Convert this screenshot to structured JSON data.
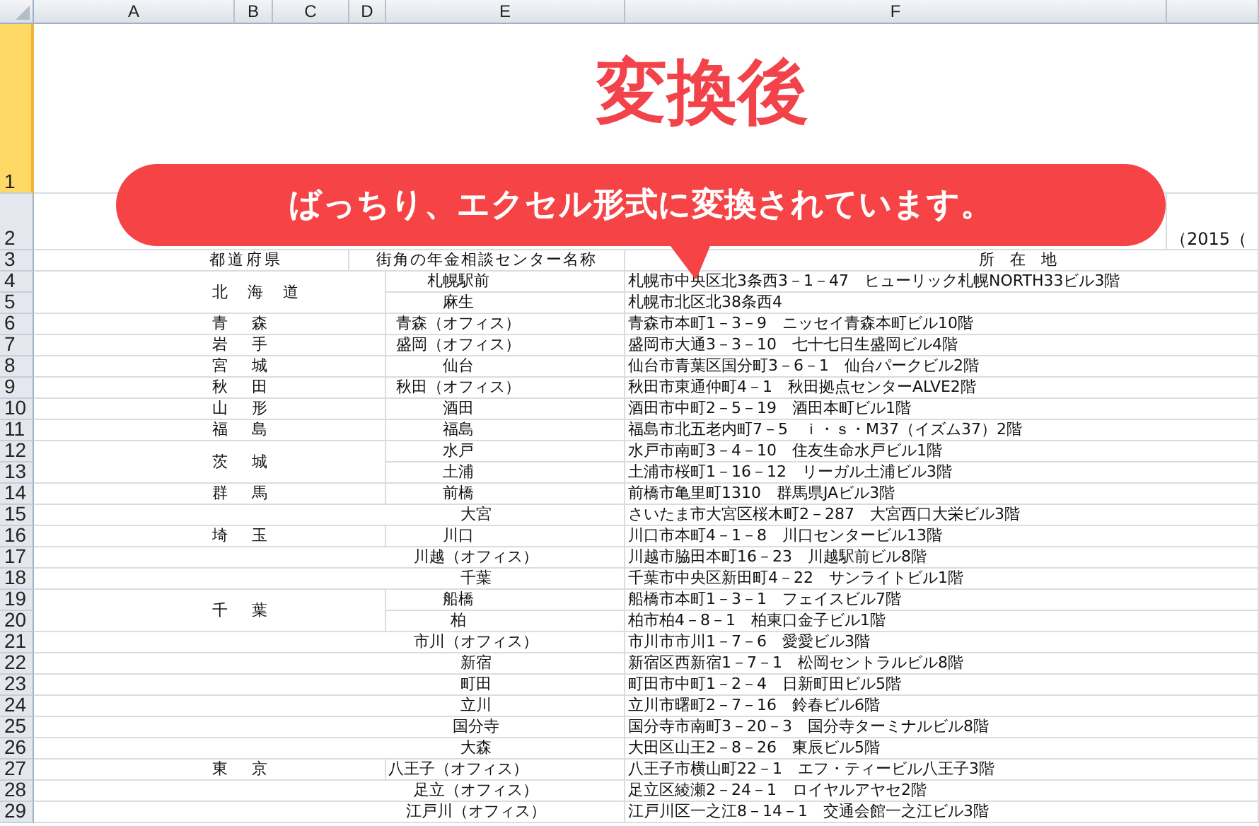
{
  "column_headers": [
    "A",
    "B",
    "C",
    "D",
    "E",
    "F"
  ],
  "row_headers": [
    {
      "label": "1",
      "selected": true
    },
    {
      "label": "2",
      "selected": false
    },
    {
      "label": "3",
      "selected": false
    },
    {
      "label": "4",
      "selected": false
    },
    {
      "label": "5",
      "selected": false
    },
    {
      "label": "6",
      "selected": false
    },
    {
      "label": "7",
      "selected": false
    },
    {
      "label": "8",
      "selected": false
    },
    {
      "label": "9",
      "selected": false
    },
    {
      "label": "10",
      "selected": false
    },
    {
      "label": "11",
      "selected": false
    },
    {
      "label": "12",
      "selected": false
    },
    {
      "label": "13",
      "selected": false
    },
    {
      "label": "14",
      "selected": false
    },
    {
      "label": "15",
      "selected": false
    },
    {
      "label": "16",
      "selected": false
    },
    {
      "label": "17",
      "selected": false
    },
    {
      "label": "18",
      "selected": false
    },
    {
      "label": "19",
      "selected": false
    },
    {
      "label": "20",
      "selected": false
    },
    {
      "label": "21",
      "selected": false
    },
    {
      "label": "22",
      "selected": false
    },
    {
      "label": "23",
      "selected": false
    },
    {
      "label": "24",
      "selected": false
    },
    {
      "label": "25",
      "selected": false
    },
    {
      "label": "26",
      "selected": false
    },
    {
      "label": "27",
      "selected": false
    },
    {
      "label": "28",
      "selected": false
    },
    {
      "label": "29",
      "selected": false
    }
  ],
  "title": "変換後",
  "callout": "ばっちり、エクセル形式に変換されています。",
  "note": "（2015（",
  "header_row": {
    "prefecture": "都道府県",
    "office": "街角の年金相談センター名称",
    "address": "所　在　地"
  },
  "groups": [
    {
      "prefecture": "北海道",
      "offices": [
        {
          "name": "札幌駅前",
          "address": "札幌市中央区北3条西3－1－47　ヒューリック札幌NORTH33ビル3階"
        },
        {
          "name": "麻生",
          "address": "札幌市北区北38条西4"
        }
      ]
    },
    {
      "prefecture": "青森",
      "offices": [
        {
          "name": "青森（オフィス）",
          "address": "青森市本町1－3－9　ニッセイ青森本町ビル10階"
        }
      ]
    },
    {
      "prefecture": "岩手",
      "offices": [
        {
          "name": "盛岡（オフィス）",
          "address": "盛岡市大通3－3－10　七十七日生盛岡ビル4階"
        }
      ]
    },
    {
      "prefecture": "宮城",
      "offices": [
        {
          "name": "仙台",
          "address": "仙台市青葉区国分町3－6－1　仙台パークビル2階"
        }
      ]
    },
    {
      "prefecture": "秋田",
      "offices": [
        {
          "name": "秋田（オフィス）",
          "address": "秋田市東通仲町4－1　秋田拠点センターALVE2階"
        }
      ]
    },
    {
      "prefecture": "山形",
      "offices": [
        {
          "name": "酒田",
          "address": "酒田市中町2－5－19　酒田本町ビル1階"
        }
      ]
    },
    {
      "prefecture": "福島",
      "offices": [
        {
          "name": "福島",
          "address": "福島市北五老内町7－5　ｉ・ｓ・M37（イズム37）2階"
        }
      ]
    },
    {
      "prefecture": "茨城",
      "offices": [
        {
          "name": "水戸",
          "address": "水戸市南町3－4－10　住友生命水戸ビル1階"
        },
        {
          "name": "土浦",
          "address": "土浦市桜町1－16－12　リーガル土浦ビル3階"
        }
      ]
    },
    {
      "prefecture": "群馬",
      "offices": [
        {
          "name": "前橋",
          "address": "前橋市亀里町1310　群馬県JAビル3階"
        }
      ]
    },
    {
      "offices": [
        {
          "name": "大宮",
          "address": "さいたま市大宮区桜木町2－287　大宮西口大栄ビル3階"
        }
      ]
    },
    {
      "prefecture": "埼玉",
      "offices": [
        {
          "name": "川口",
          "address": "川口市本町4－1－8　川口センタービル13階"
        }
      ]
    },
    {
      "offices": [
        {
          "name": "川越（オフィス）",
          "address": "川越市脇田本町16－23　川越駅前ビル8階"
        }
      ]
    },
    {
      "offices": [
        {
          "name": "千葉",
          "address": "千葉市中央区新田町4－22　サンライトビル1階"
        }
      ]
    },
    {
      "prefecture": "千葉",
      "offices": [
        {
          "name": "船橋",
          "address": "船橋市本町1－3－1　フェイスビル7階"
        },
        {
          "name": "柏",
          "address": "柏市柏4－8－1　柏東口金子ビル1階"
        }
      ]
    },
    {
      "offices": [
        {
          "name": "市川（オフィス）",
          "address": "市川市市川1－7－6　愛愛ビル3階"
        }
      ]
    },
    {
      "offices": [
        {
          "name": "新宿",
          "address": "新宿区西新宿1－7－1　松岡セントラルビル8階"
        }
      ]
    },
    {
      "offices": [
        {
          "name": "町田",
          "address": "町田市中町1－2－4　日新町田ビル5階"
        }
      ]
    },
    {
      "offices": [
        {
          "name": "立川",
          "address": "立川市曙町2－7－16　鈴春ビル6階"
        }
      ]
    },
    {
      "offices": [
        {
          "name": "国分寺",
          "address": "国分寺市南町3－20－3　国分寺ターミナルビル8階"
        }
      ]
    },
    {
      "offices": [
        {
          "name": "大森",
          "address": "大田区山王2－8－26　東辰ビル5階"
        }
      ]
    },
    {
      "prefecture": "東京",
      "offices": [
        {
          "name": "八王子（オフィス）",
          "address": "八王子市横山町22－1　エフ・ティービル八王子3階"
        }
      ]
    },
    {
      "offices": [
        {
          "name": "足立（オフィス）",
          "address": "足立区綾瀬2－24－1　ロイヤルアヤセ2階"
        }
      ]
    },
    {
      "offices": [
        {
          "name": "江戸川（オフィス）",
          "address": "江戸川区一之江8－14－1　交通会館一之江ビル3階"
        }
      ]
    }
  ]
}
